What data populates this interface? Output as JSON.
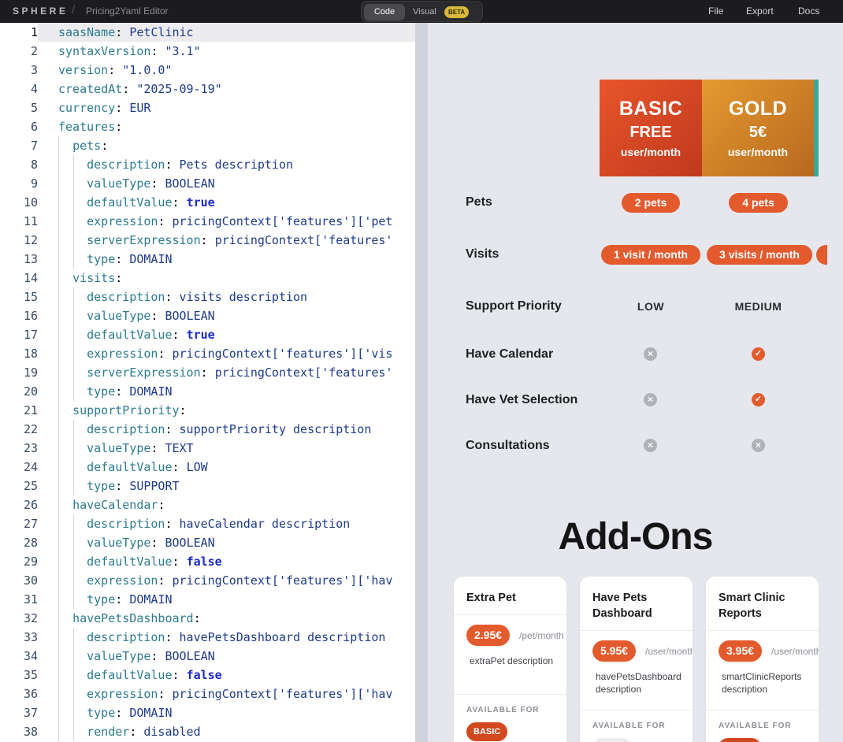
{
  "topbar": {
    "brand": "SPHERE",
    "separator": "/",
    "app_title": "Pricing2Yaml Editor",
    "modes": {
      "code": "Code",
      "visual": "Visual",
      "beta": "BETA",
      "active": "Code"
    },
    "menu": [
      "File",
      "Export",
      "Docs"
    ]
  },
  "editor": {
    "active_line": 1,
    "lines": [
      [
        [
          "k",
          "saasName"
        ],
        [
          "p",
          ": "
        ],
        [
          "v",
          "PetClinic"
        ]
      ],
      [
        [
          "k",
          "syntaxVersion"
        ],
        [
          "p",
          ": "
        ],
        [
          "v",
          "\"3.1\""
        ]
      ],
      [
        [
          "k",
          "version"
        ],
        [
          "p",
          ": "
        ],
        [
          "v",
          "\"1.0.0\""
        ]
      ],
      [
        [
          "k",
          "createdAt"
        ],
        [
          "p",
          ": "
        ],
        [
          "v",
          "\"2025-09-19\""
        ]
      ],
      [
        [
          "k",
          "currency"
        ],
        [
          "p",
          ": "
        ],
        [
          "v",
          "EUR"
        ]
      ],
      [
        [
          "k",
          "features"
        ],
        [
          "p",
          ":"
        ]
      ],
      [
        [
          "p",
          "  "
        ],
        [
          "k",
          "pets"
        ],
        [
          "p",
          ":"
        ]
      ],
      [
        [
          "p",
          "    "
        ],
        [
          "k",
          "description"
        ],
        [
          "p",
          ": "
        ],
        [
          "v",
          "Pets description"
        ]
      ],
      [
        [
          "p",
          "    "
        ],
        [
          "k",
          "valueType"
        ],
        [
          "p",
          ": "
        ],
        [
          "v",
          "BOOLEAN"
        ]
      ],
      [
        [
          "p",
          "    "
        ],
        [
          "k",
          "defaultValue"
        ],
        [
          "p",
          ": "
        ],
        [
          "b",
          "true"
        ]
      ],
      [
        [
          "p",
          "    "
        ],
        [
          "k",
          "expression"
        ],
        [
          "p",
          ": "
        ],
        [
          "v",
          "pricingContext['features']['pet"
        ]
      ],
      [
        [
          "p",
          "    "
        ],
        [
          "k",
          "serverExpression"
        ],
        [
          "p",
          ": "
        ],
        [
          "v",
          "pricingContext['features'"
        ]
      ],
      [
        [
          "p",
          "    "
        ],
        [
          "k",
          "type"
        ],
        [
          "p",
          ": "
        ],
        [
          "v",
          "DOMAIN"
        ]
      ],
      [
        [
          "p",
          "  "
        ],
        [
          "k",
          "visits"
        ],
        [
          "p",
          ":"
        ]
      ],
      [
        [
          "p",
          "    "
        ],
        [
          "k",
          "description"
        ],
        [
          "p",
          ": "
        ],
        [
          "v",
          "visits description"
        ]
      ],
      [
        [
          "p",
          "    "
        ],
        [
          "k",
          "valueType"
        ],
        [
          "p",
          ": "
        ],
        [
          "v",
          "BOOLEAN"
        ]
      ],
      [
        [
          "p",
          "    "
        ],
        [
          "k",
          "defaultValue"
        ],
        [
          "p",
          ": "
        ],
        [
          "b",
          "true"
        ]
      ],
      [
        [
          "p",
          "    "
        ],
        [
          "k",
          "expression"
        ],
        [
          "p",
          ": "
        ],
        [
          "v",
          "pricingContext['features']['vis"
        ]
      ],
      [
        [
          "p",
          "    "
        ],
        [
          "k",
          "serverExpression"
        ],
        [
          "p",
          ": "
        ],
        [
          "v",
          "pricingContext['features'"
        ]
      ],
      [
        [
          "p",
          "    "
        ],
        [
          "k",
          "type"
        ],
        [
          "p",
          ": "
        ],
        [
          "v",
          "DOMAIN"
        ]
      ],
      [
        [
          "p",
          "  "
        ],
        [
          "k",
          "supportPriority"
        ],
        [
          "p",
          ":"
        ]
      ],
      [
        [
          "p",
          "    "
        ],
        [
          "k",
          "description"
        ],
        [
          "p",
          ": "
        ],
        [
          "v",
          "supportPriority description"
        ]
      ],
      [
        [
          "p",
          "    "
        ],
        [
          "k",
          "valueType"
        ],
        [
          "p",
          ": "
        ],
        [
          "v",
          "TEXT"
        ]
      ],
      [
        [
          "p",
          "    "
        ],
        [
          "k",
          "defaultValue"
        ],
        [
          "p",
          ": "
        ],
        [
          "v",
          "LOW"
        ]
      ],
      [
        [
          "p",
          "    "
        ],
        [
          "k",
          "type"
        ],
        [
          "p",
          ": "
        ],
        [
          "v",
          "SUPPORT"
        ]
      ],
      [
        [
          "p",
          "  "
        ],
        [
          "k",
          "haveCalendar"
        ],
        [
          "p",
          ":"
        ]
      ],
      [
        [
          "p",
          "    "
        ],
        [
          "k",
          "description"
        ],
        [
          "p",
          ": "
        ],
        [
          "v",
          "haveCalendar description"
        ]
      ],
      [
        [
          "p",
          "    "
        ],
        [
          "k",
          "valueType"
        ],
        [
          "p",
          ": "
        ],
        [
          "v",
          "BOOLEAN"
        ]
      ],
      [
        [
          "p",
          "    "
        ],
        [
          "k",
          "defaultValue"
        ],
        [
          "p",
          ": "
        ],
        [
          "b",
          "false"
        ]
      ],
      [
        [
          "p",
          "    "
        ],
        [
          "k",
          "expression"
        ],
        [
          "p",
          ": "
        ],
        [
          "v",
          "pricingContext['features']['hav"
        ]
      ],
      [
        [
          "p",
          "    "
        ],
        [
          "k",
          "type"
        ],
        [
          "p",
          ": "
        ],
        [
          "v",
          "DOMAIN"
        ]
      ],
      [
        [
          "p",
          "  "
        ],
        [
          "k",
          "havePetsDashboard"
        ],
        [
          "p",
          ":"
        ]
      ],
      [
        [
          "p",
          "    "
        ],
        [
          "k",
          "description"
        ],
        [
          "p",
          ": "
        ],
        [
          "v",
          "havePetsDashboard description"
        ]
      ],
      [
        [
          "p",
          "    "
        ],
        [
          "k",
          "valueType"
        ],
        [
          "p",
          ": "
        ],
        [
          "v",
          "BOOLEAN"
        ]
      ],
      [
        [
          "p",
          "    "
        ],
        [
          "k",
          "defaultValue"
        ],
        [
          "p",
          ": "
        ],
        [
          "b",
          "false"
        ]
      ],
      [
        [
          "p",
          "    "
        ],
        [
          "k",
          "expression"
        ],
        [
          "p",
          ": "
        ],
        [
          "v",
          "pricingContext['features']['hav"
        ]
      ],
      [
        [
          "p",
          "    "
        ],
        [
          "k",
          "type"
        ],
        [
          "p",
          ": "
        ],
        [
          "v",
          "DOMAIN"
        ]
      ],
      [
        [
          "p",
          "    "
        ],
        [
          "k",
          "render"
        ],
        [
          "p",
          ": "
        ],
        [
          "v",
          "disabled"
        ]
      ]
    ]
  },
  "preview": {
    "plans": [
      {
        "name": "BASIC",
        "price": "FREE",
        "unit": "user/month",
        "color": "#e35a2d"
      },
      {
        "name": "GOLD",
        "price": "5€",
        "unit": "user/month",
        "color": "#d98a2b"
      }
    ],
    "features": {
      "pets": {
        "label": "Pets",
        "basic": "2 pets",
        "gold": "4 pets"
      },
      "visits": {
        "label": "Visits",
        "basic": "1 visit / month",
        "gold": "3 visits / month"
      },
      "support": {
        "label": "Support Priority",
        "basic": "LOW",
        "gold": "MEDIUM"
      },
      "calendar": {
        "label": "Have Calendar",
        "basic": "cross-icon",
        "gold": "check-icon"
      },
      "vet": {
        "label": "Have Vet Selection",
        "basic": "cross-icon",
        "gold": "check-icon"
      },
      "consult": {
        "label": "Consultations",
        "basic": "cross-icon",
        "gold": "cross-icon"
      }
    },
    "addons_title": "Add-Ons",
    "addons": [
      {
        "name": "Extra Pet",
        "price": "2.95€",
        "unit": "/pet/month",
        "description": "extraPet description",
        "available_label": "AVAILABLE FOR",
        "available": "BASIC"
      },
      {
        "name": "Have Pets Dashboard",
        "price": "5.95€",
        "unit": "/user/month",
        "description": "havePetsDashboard description",
        "available_label": "AVAILABLE FOR",
        "available": ""
      },
      {
        "name": "Smart Clinic Reports",
        "price": "3.95€",
        "unit": "/user/month",
        "description": "smartClinicReports description",
        "available_label": "AVAILABLE FOR",
        "available": ""
      }
    ]
  }
}
